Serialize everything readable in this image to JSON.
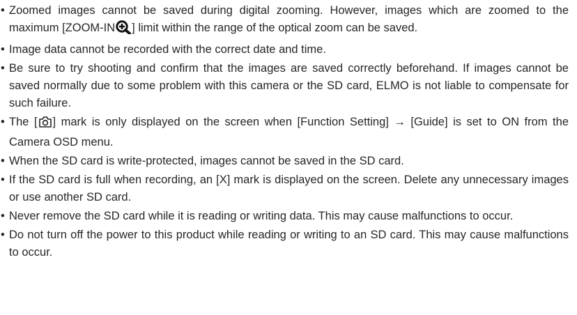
{
  "notes": [
    {
      "before": "Zoomed images cannot be saved during digital zooming. However, images which are zoomed to the maximum [ZOOM-IN",
      "icon": "zoom-in-magnifier-plus-icon",
      "after": "] limit within the range of the optical zoom can be saved."
    },
    {
      "text": "Image data cannot be recorded with the correct date and time."
    },
    {
      "text": "Be sure to try shooting and confirm that the images are saved correctly beforehand. If images cannot be saved normally due to some problem with this camera or the SD card, ELMO is not liable to compensate for such failure."
    },
    {
      "before": "The [",
      "icon": "camera-icon",
      "after": "] mark is only displayed on the screen when [Function Setting] → [Guide] is set to ON from the Camera OSD menu."
    },
    {
      "text": "When the SD card is write-protected, images cannot be saved in the SD card."
    },
    {
      "text": "If the SD card is full when recording, an [X] mark is displayed on the screen. Delete any unnecessary images or use another SD card."
    },
    {
      "text": "Never remove the SD card while it is reading or writing data. This may cause malfunctions to occur."
    },
    {
      "text": "Do not turn off the power to this product while reading or writing to an SD card. This may cause malfunctions to occur."
    }
  ],
  "bullet": "•"
}
